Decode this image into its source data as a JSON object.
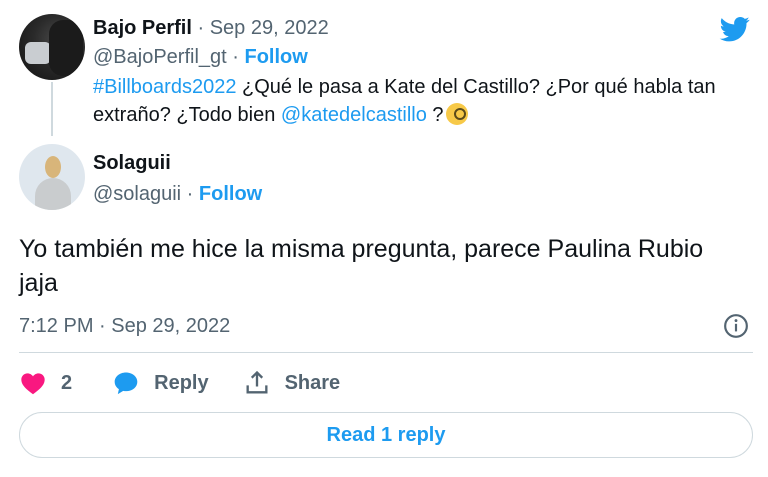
{
  "parent_tweet": {
    "display_name": "Bajo Perfil",
    "separator": " · ",
    "date": "Sep 29, 2022",
    "handle": "@BajoPerfil_gt",
    "follow_label": "Follow",
    "hashtag": "#Billboards2022",
    "text_part1": " ¿Qué le pasa a Kate del Castillo? ¿Por qué habla tan extraño? ¿Todo bien ",
    "mention": "@katedelcastillo",
    "text_part2": " ?"
  },
  "reply_tweet": {
    "display_name": "Solaguii",
    "handle": "@solaguii",
    "separator": " · ",
    "follow_label": "Follow",
    "text": "Yo también me hice la misma pregunta, parece  Paulina Rubio jaja",
    "timestamp": "7:12 PM · Sep 29, 2022"
  },
  "actions": {
    "like_count": "2",
    "reply_label": "Reply",
    "share_label": "Share"
  },
  "read_reply_label": "Read 1 reply",
  "colors": {
    "accent": "#1d9bf0",
    "like": "#f91880",
    "muted": "#536471",
    "text": "#0f1419",
    "border": "#cfd9de"
  },
  "icons": {
    "brand": "twitter-bird-icon",
    "info": "info-icon",
    "like": "heart-icon",
    "reply": "speech-bubble-icon",
    "share": "share-upload-icon"
  }
}
